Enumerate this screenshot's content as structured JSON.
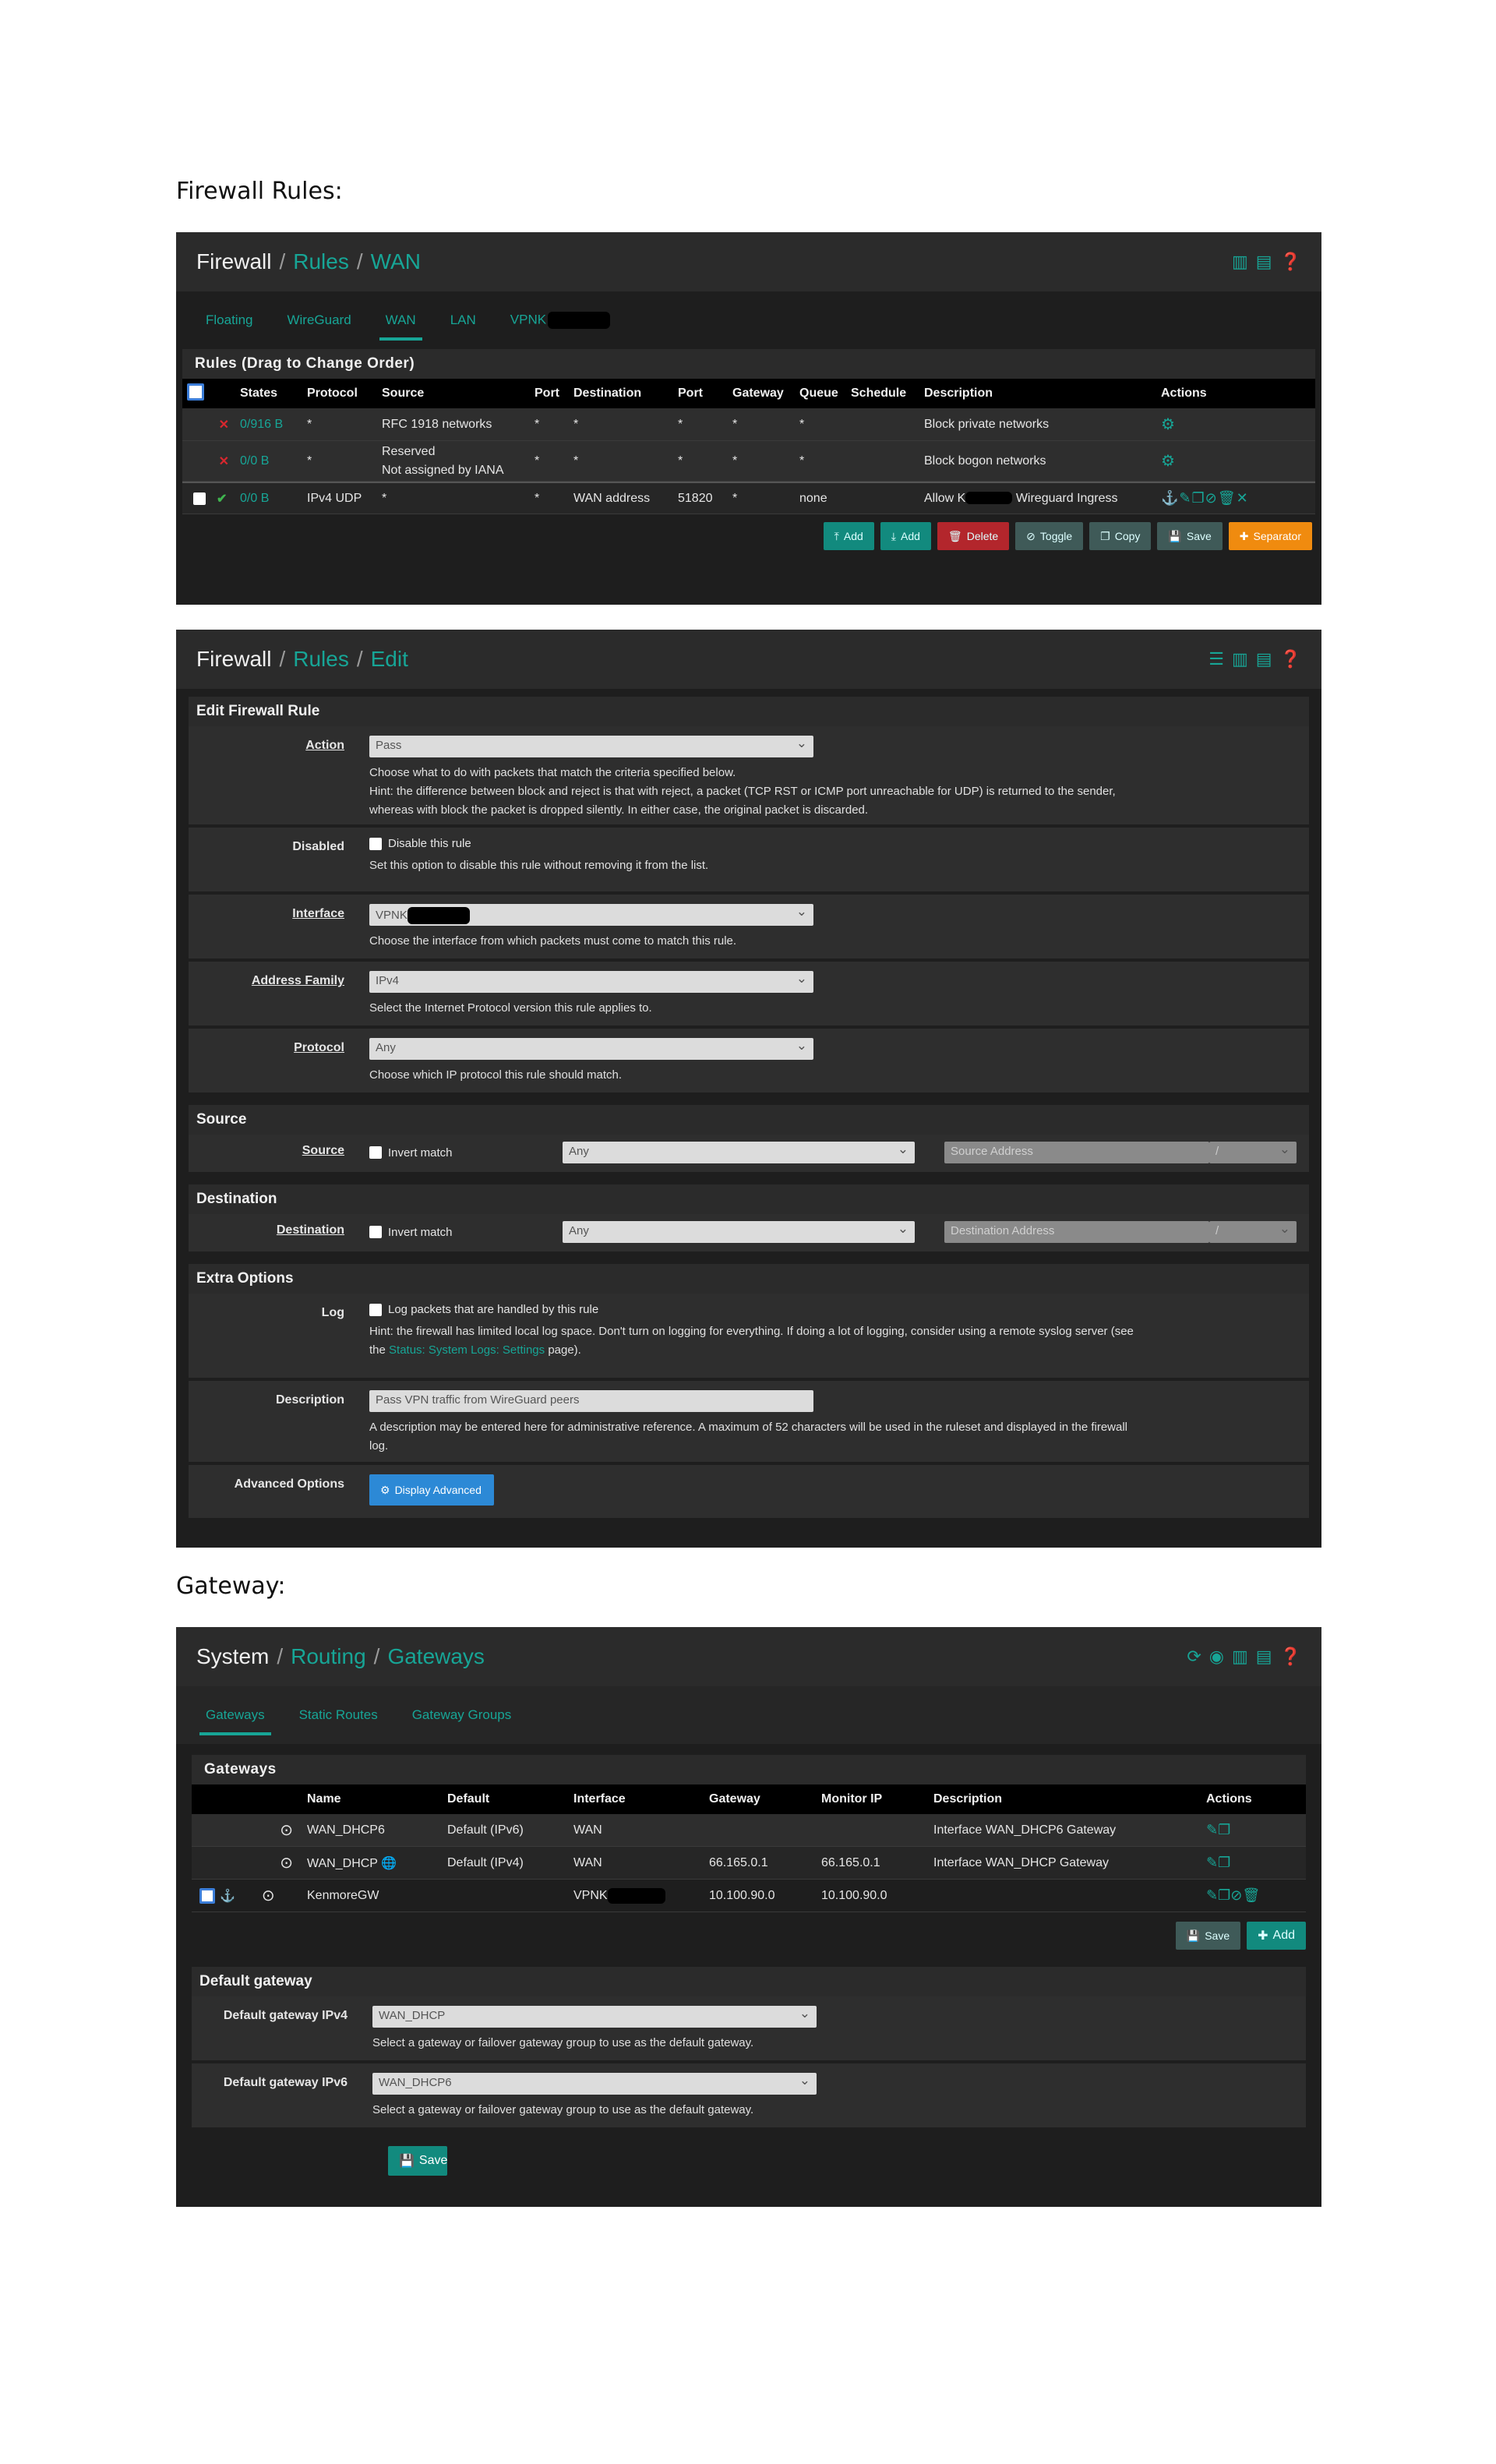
{
  "doc": {
    "heading1": "Firewall Rules:",
    "heading2": "Gateway:"
  },
  "rules": {
    "bc1": "Firewall",
    "bc2": "Rules",
    "bc3": "WAN",
    "tabs": [
      "Floating",
      "WireGuard",
      "WAN",
      "LAN",
      "VPNK"
    ],
    "section": "Rules (Drag to Change Order)",
    "headers": [
      "States",
      "Protocol",
      "Source",
      "Port",
      "Destination",
      "Port",
      "Gateway",
      "Queue",
      "Schedule",
      "Description",
      "Actions"
    ],
    "rows": [
      {
        "states": "0/916 B",
        "protocol": "*",
        "source": "RFC 1918 networks",
        "sport": "*",
        "dest": "*",
        "dport": "*",
        "gateway": "*",
        "queue": "*",
        "schedule": "",
        "desc": "Block private networks"
      },
      {
        "states": "0/0 B",
        "protocol": "*",
        "source": "Reserved",
        "source2": "Not assigned by IANA",
        "sport": "*",
        "dest": "*",
        "dport": "*",
        "gateway": "*",
        "queue": "*",
        "schedule": "",
        "desc": "Block bogon networks"
      },
      {
        "states": "0/0 B",
        "protocol": "IPv4 UDP",
        "source": "*",
        "sport": "*",
        "dest": "WAN address",
        "dport": "51820",
        "gateway": "*",
        "queue": "none",
        "schedule": "",
        "desc_a": "Allow K",
        "desc_b": "Wireguard Ingress"
      }
    ],
    "buttons": {
      "add1": "Add",
      "add2": "Add",
      "delete": "Delete",
      "toggle": "Toggle",
      "copy": "Copy",
      "save": "Save",
      "separator": "Separator"
    }
  },
  "edit": {
    "bc1": "Firewall",
    "bc2": "Rules",
    "bc3": "Edit",
    "section": "Edit Firewall Rule",
    "action": {
      "label": "Action",
      "value": "Pass",
      "help1": "Choose what to do with packets that match the criteria specified below.",
      "help2": "Hint: the difference between block and reject is that with reject, a packet (TCP RST or ICMP port unreachable for UDP) is returned to the sender,",
      "help3": "whereas with block the packet is dropped silently. In either case, the original packet is discarded."
    },
    "disabled": {
      "label": "Disabled",
      "cb": "Disable this rule",
      "help": "Set this option to disable this rule without removing it from the list."
    },
    "interface": {
      "label": "Interface",
      "value": "VPNK",
      "help": "Choose the interface from which packets must come to match this rule."
    },
    "family": {
      "label": "Address Family",
      "value": "IPv4",
      "help": "Select the Internet Protocol version this rule applies to."
    },
    "protocol": {
      "label": "Protocol",
      "value": "Any",
      "help": "Choose which IP protocol this rule should match."
    },
    "source_sect": "Source",
    "source": {
      "label": "Source",
      "cb": "Invert match",
      "sel": "Any",
      "addr": "Source Address",
      "slash": "/"
    },
    "dest_sect": "Destination",
    "dest": {
      "label": "Destination",
      "cb": "Invert match",
      "sel": "Any",
      "addr": "Destination Address",
      "slash": "/"
    },
    "extra_sect": "Extra Options",
    "log": {
      "label": "Log",
      "cb": "Log packets that are handled by this rule",
      "help_a": "Hint: the firewall has limited local log space. Don't turn on logging for everything. If doing a lot of logging, consider using a remote syslog server (see",
      "help_b": "the",
      "help_link": "Status: System Logs: Settings",
      "help_c": "page)."
    },
    "desc": {
      "label": "Description",
      "value": "Pass VPN traffic from WireGuard peers",
      "help1": "A description may be entered here for administrative reference. A maximum of 52 characters will be used in the ruleset and displayed in the firewall",
      "help2": "log."
    },
    "adv": {
      "label": "Advanced Options",
      "button": "Display Advanced"
    }
  },
  "gw": {
    "bc1": "System",
    "bc2": "Routing",
    "bc3": "Gateways",
    "tabs": [
      "Gateways",
      "Static Routes",
      "Gateway Groups"
    ],
    "section": "Gateways",
    "headers": [
      "Name",
      "Default",
      "Interface",
      "Gateway",
      "Monitor IP",
      "Description",
      "Actions"
    ],
    "rows": [
      {
        "name": "WAN_DHCP6",
        "default": "Default (IPv6)",
        "iface": "WAN",
        "gateway": "",
        "monitor": "",
        "desc": "Interface WAN_DHCP6 Gateway"
      },
      {
        "name": "WAN_DHCP",
        "default": "Default (IPv4)",
        "iface": "WAN",
        "gateway": "66.165.0.1",
        "monitor": "66.165.0.1",
        "desc": "Interface WAN_DHCP Gateway"
      },
      {
        "name": "KenmoreGW",
        "default": "",
        "iface": "VPNK",
        "gateway": "10.100.90.0",
        "monitor": "10.100.90.0",
        "desc": ""
      }
    ],
    "save": "Save",
    "add": "Add",
    "def_sect": "Default gateway",
    "v4": {
      "label": "Default gateway IPv4",
      "value": "WAN_DHCP",
      "help": "Select a gateway or failover gateway group to use as the default gateway."
    },
    "v6": {
      "label": "Default gateway IPv6",
      "value": "WAN_DHCP6",
      "help": "Select a gateway or failover gateway group to use as the default gateway."
    },
    "save2": "Save"
  }
}
